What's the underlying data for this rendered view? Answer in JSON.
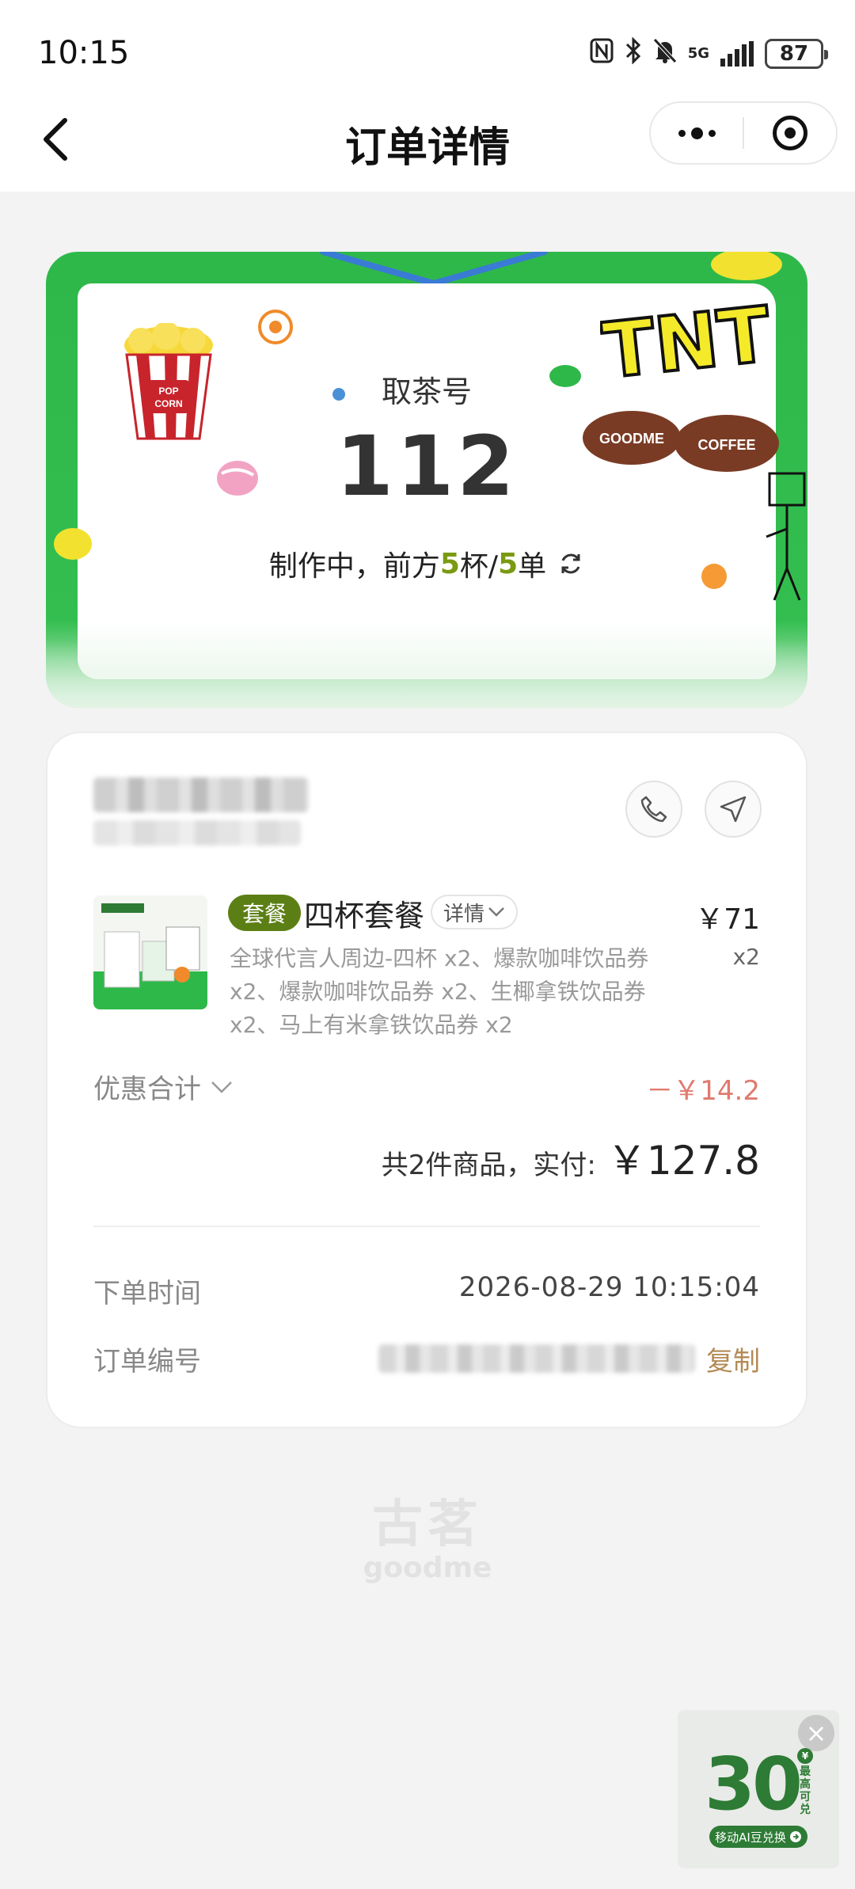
{
  "status_bar": {
    "time": "10:15",
    "network": "5G",
    "battery": "87"
  },
  "nav": {
    "title": "订单详情"
  },
  "pickup": {
    "label": "取茶号",
    "number": "112",
    "status_prefix": "制作中，前方",
    "cups": "5",
    "cups_unit": "杯/",
    "orders": "5",
    "orders_unit": "单",
    "deco": {
      "popcorn_text_1": "POP",
      "popcorn_text_2": "CORN",
      "brand_badge": "TNT",
      "cup_text_1": "GOODME",
      "cup_text_2": "COFFEE"
    }
  },
  "order": {
    "product": {
      "badge": "套餐",
      "name": "四杯套餐",
      "detail_label": "详情",
      "price": "￥71",
      "qty": "x2",
      "description": "全球代言人周边-四杯 x2、爆款咖啡饮品券 x2、爆款咖啡饮品券 x2、生椰拿铁饮品券 x2、马上有米拿铁饮品券 x2"
    },
    "discount_label": "优惠合计",
    "discount_value": "－￥14.2",
    "total_label": "共2件商品，实付:",
    "total_amount": "￥127.8",
    "order_time_label": "下单时间",
    "order_time_value": "2026-08-29 10:15:04",
    "order_no_label": "订单编号",
    "copy_label": "复制"
  },
  "footer": {
    "logo_cn": "古茗",
    "logo_en": "goodme"
  },
  "promo": {
    "amount": "30",
    "side_text": "最高可兑",
    "yen": "¥",
    "pill_text": "移动AI豆兑换",
    "close": "×"
  },
  "colors": {
    "brand_green": "#2eb84a",
    "accent_olive": "#5c7f15",
    "discount_red": "#e07a6e",
    "copy_gold": "#b38a55"
  }
}
